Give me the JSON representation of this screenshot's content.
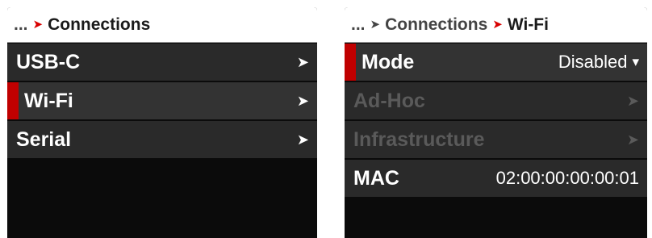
{
  "left": {
    "breadcrumb": {
      "ellipsis": "...",
      "separator": "➤",
      "current": "Connections"
    },
    "items": [
      {
        "label": "USB-C",
        "arrow": "➤",
        "selected": false
      },
      {
        "label": "Wi-Fi",
        "arrow": "➤",
        "selected": true
      },
      {
        "label": "Serial",
        "arrow": "➤",
        "selected": false
      }
    ]
  },
  "right": {
    "breadcrumb": {
      "ellipsis": "...",
      "separator1": "➤",
      "parent": "Connections",
      "separator2": "➤",
      "current": "Wi-Fi"
    },
    "items": [
      {
        "label": "Mode",
        "value": "Disabled",
        "dropdown": "▾",
        "selected": true
      },
      {
        "label": "Ad-Hoc",
        "arrow": "➤",
        "disabled": true
      },
      {
        "label": "Infrastructure",
        "arrow": "➤",
        "disabled": true
      },
      {
        "label": "MAC",
        "value": "02:00:00:00:00:01"
      }
    ]
  },
  "colors": {
    "accent": "#d80000",
    "selection": "#c00000",
    "row_bg": "#2a2a2a",
    "panel_bg": "#0b0b0b",
    "disabled_text": "#5a5a5a"
  }
}
